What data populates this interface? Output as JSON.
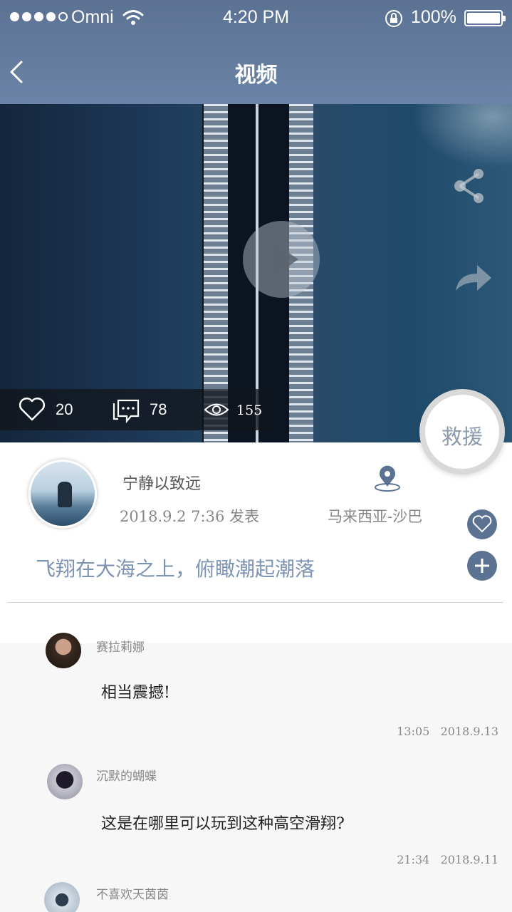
{
  "status_bar": {
    "carrier": "Omni",
    "time": "4:20 PM",
    "battery": "100%"
  },
  "nav": {
    "title": "视频"
  },
  "video": {
    "likes": "20",
    "comments": "78",
    "views": "155"
  },
  "rescue_label": "救援",
  "post": {
    "author": "宁静以致远",
    "posted": "2018.9.2 7:36 发表",
    "location": "马来西亚-沙巴",
    "caption": "飞翔在大海之上，俯瞰潮起潮落"
  },
  "comments": [
    {
      "name": "赛拉莉娜",
      "text": "相当震撼!",
      "time": "13:05   2018.9.13"
    },
    {
      "name": "沉默的蝴蝶",
      "text": "这是在哪里可以玩到这种高空滑翔?",
      "time": "21:34   2018.9.11"
    },
    {
      "name": "不喜欢天茵茵"
    }
  ],
  "colors": {
    "header": "#5b7293",
    "accent_text": "#7d93b2"
  }
}
